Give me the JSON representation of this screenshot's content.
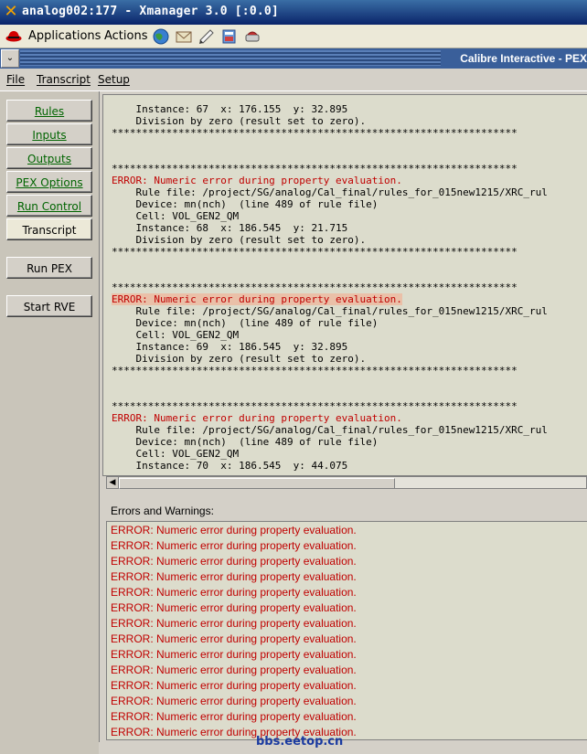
{
  "x_window": {
    "title": "analog002:177 - Xmanager 3.0 [:0.0]",
    "icon": "x-logo-icon"
  },
  "panel": {
    "menus": [
      "Applications",
      "Actions"
    ],
    "launchers": [
      "browser-icon",
      "mail-icon",
      "notes-icon",
      "office-icon",
      "print-icon"
    ]
  },
  "app": {
    "title": "Calibre Interactive - PEX"
  },
  "menubar": {
    "items": [
      "File",
      "Transcript",
      "Setup"
    ]
  },
  "nav": {
    "items": [
      "Rules",
      "Inputs",
      "Outputs",
      "PEX Options",
      "Run Control",
      "Transcript"
    ],
    "active": "Transcript",
    "run_pex": "Run PEX",
    "start_rve": "Start RVE"
  },
  "transcript": {
    "lines": [
      "    Instance: 67  x: 176.155  y: 32.895",
      "    Division by zero (result set to zero).",
      "*******************************************************************",
      "",
      "",
      "*******************************************************************",
      "ERROR: Numeric error during property evaluation.",
      "    Rule file: /project/SG/analog/Cal_final/rules_for_015new1215/XRC_rul",
      "    Device: mn(nch)  (line 489 of rule file)",
      "    Cell: VOL_GEN2_QM",
      "    Instance: 68  x: 186.545  y: 21.715",
      "    Division by zero (result set to zero).",
      "*******************************************************************",
      "",
      "",
      "*******************************************************************",
      "ERROR: Numeric error during property evaluation.",
      "    Rule file: /project/SG/analog/Cal_final/rules_for_015new1215/XRC_rul",
      "    Device: mn(nch)  (line 489 of rule file)",
      "    Cell: VOL_GEN2_QM",
      "    Instance: 69  x: 186.545  y: 32.895",
      "    Division by zero (result set to zero).",
      "*******************************************************************",
      "",
      "",
      "*******************************************************************",
      "ERROR: Numeric error during property evaluation.",
      "    Rule file: /project/SG/analog/Cal_final/rules_for_015new1215/XRC_rul",
      "    Device: mn(nch)  (line 489 of rule file)",
      "    Cell: VOL_GEN2_QM",
      "    Instance: 70  x: 186.545  y: 44.075"
    ]
  },
  "errors": {
    "label": "Errors and Warnings:",
    "items": [
      "ERROR: Numeric error during property evaluation.",
      "ERROR: Numeric error during property evaluation.",
      "ERROR: Numeric error during property evaluation.",
      "ERROR: Numeric error during property evaluation.",
      "ERROR: Numeric error during property evaluation.",
      "ERROR: Numeric error during property evaluation.",
      "ERROR: Numeric error during property evaluation.",
      "ERROR: Numeric error during property evaluation.",
      "ERROR: Numeric error during property evaluation.",
      "ERROR: Numeric error during property evaluation.",
      "ERROR: Numeric error during property evaluation.",
      "ERROR: Numeric error during property evaluation.",
      "ERROR: Numeric error during property evaluation.",
      "ERROR: Numeric error during property evaluation."
    ]
  },
  "watermark": "bbs.eetop.cn"
}
